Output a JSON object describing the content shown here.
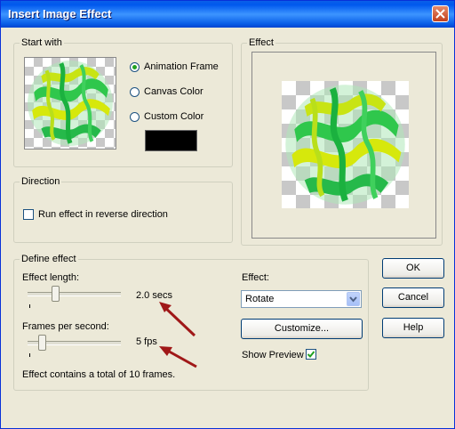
{
  "window": {
    "title": "Insert Image Effect"
  },
  "start_with": {
    "legend": "Start with",
    "options": [
      {
        "label": "Animation Frame",
        "selected": true
      },
      {
        "label": "Canvas Color",
        "selected": false
      },
      {
        "label": "Custom Color",
        "selected": false
      }
    ],
    "custom_color": "#000000"
  },
  "effect_preview": {
    "legend": "Effect"
  },
  "direction": {
    "legend": "Direction",
    "reverse_label": "Run effect in reverse direction",
    "reverse_checked": false
  },
  "define_effect": {
    "legend": "Define effect",
    "length_label": "Effect length:",
    "length_value": "2.0 secs",
    "length_fraction": 0.28,
    "fps_label": "Frames per second:",
    "fps_value": "5 fps",
    "fps_fraction": 0.12,
    "summary": "Effect contains a total of 10 frames.",
    "effect_label": "Effect:",
    "effect_selected": "Rotate",
    "customize_label": "Customize...",
    "show_preview_label": "Show Preview",
    "show_preview_checked": true
  },
  "buttons": {
    "ok": "OK",
    "cancel": "Cancel",
    "help": "Help"
  },
  "colors": {
    "title_bar": "#0a5fe8",
    "dialog_bg": "#ece9d8",
    "annotation_arrow": "#a01818",
    "sphere_green": "#22c84a",
    "sphere_yellow": "#d2e60a"
  }
}
